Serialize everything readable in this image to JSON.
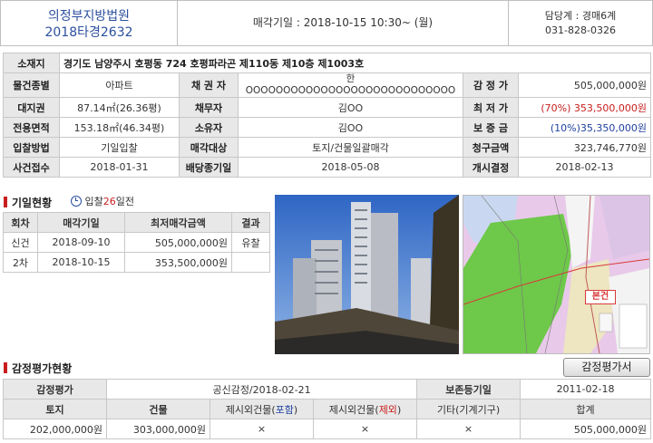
{
  "header": {
    "court": "의정부지방법원",
    "case_no": "2018타경2632",
    "sale_date": "매각기일 : 2018-10-15   10:30~ (월)",
    "manager": "담당계 : 경매6계",
    "phone": "031-828-0326"
  },
  "info": {
    "location_label": "소재지",
    "location": "경기도 남양주시 호평동 724 호평파라곤 제110동 제10층 제1003호",
    "type_label": "물건종별",
    "type": "아파트",
    "creditor_label": "채 권 자",
    "creditor_line1": "한",
    "creditor_line2": "OOOOOOOOOOOOOOOOOOOOOOOOOOOO",
    "appraisal_label": "감 정 가",
    "appraisal": "505,000,000원",
    "land_label": "대지권",
    "land": "87.14㎡(26.36평)",
    "debtor_label": "채무자",
    "debtor": "김OO",
    "min_label": "최 저 가",
    "min_pct": "(70%)",
    "min_price": "353,500,000원",
    "area_label": "전용면적",
    "area": "153.18㎡(46.34평)",
    "owner_label": "소유자",
    "owner": "김OO",
    "deposit_label": "보 증 금",
    "deposit": "(10%)35,350,000원",
    "bid_label": "입찰방법",
    "bid": "기일입찰",
    "target_label": "매각대상",
    "target": "토지/건물일괄매각",
    "claim_label": "청구금액",
    "claim": "323,746,770원",
    "receipt_label": "사건접수",
    "receipt": "2018-01-31",
    "dist_label": "배당종기일",
    "dist": "2018-05-08",
    "open_label": "개시결정",
    "open": "2018-02-13"
  },
  "schedule": {
    "title": "기일현황",
    "badge_prefix": "입찰",
    "badge_days": "26",
    "badge_suffix": "일전",
    "headers": [
      "회차",
      "매각기일",
      "최저매각금액",
      "결과"
    ],
    "rows": [
      {
        "round": "신건",
        "date": "2018-09-10",
        "price": "505,000,000원",
        "result": "유찰"
      },
      {
        "round": "2차",
        "date": "2018-10-15",
        "price": "353,500,000원",
        "result": ""
      }
    ]
  },
  "map": {
    "label": "본건"
  },
  "appraisal": {
    "title": "감정평가현황",
    "button": "감정평가서",
    "h_label": "감정평가",
    "h_value": "공신감정/2018-02-21",
    "preserve_label": "보존등기일",
    "preserve_value": "2011-02-18",
    "cols": {
      "land": "토지",
      "building": "건물",
      "incl_prefix": "제시외건물(",
      "incl_word": "포함",
      "incl_suffix": ")",
      "excl_prefix": "제시외건물(",
      "excl_word": "제외",
      "excl_suffix": ")",
      "etc": "기타(기계기구)",
      "total": "합계"
    },
    "values": {
      "land": "202,000,000원",
      "building": "303,000,000원",
      "incl": "×",
      "excl": "×",
      "etc": "×",
      "total": "505,000,000원"
    }
  },
  "colors": {
    "accent_red": "#c81e1e",
    "accent_blue": "#2b4f9e"
  }
}
